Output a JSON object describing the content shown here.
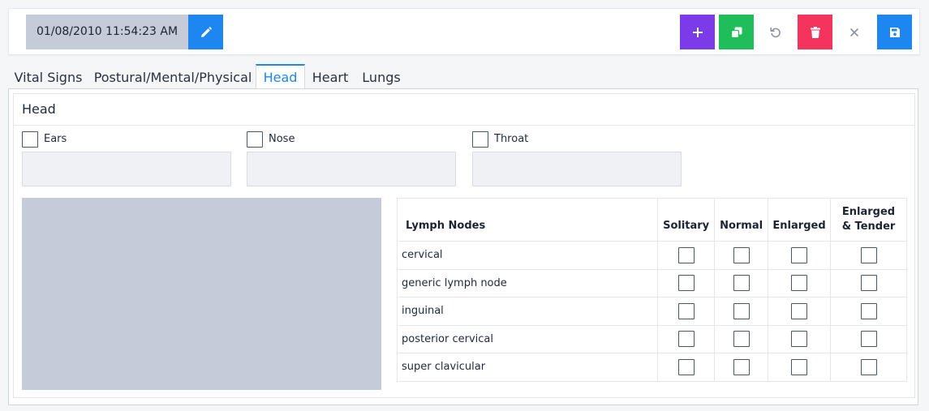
{
  "toolbar": {
    "datetime": "01/08/2010 11:54:23 AM",
    "colors": {
      "add": "#7b3be8",
      "copy": "#1fbe5b",
      "delete": "#f5345e",
      "primary": "#1e86f0"
    },
    "icons": [
      "pencil-icon",
      "plus-icon",
      "copy-icon",
      "undo-icon",
      "trash-icon",
      "close-icon",
      "save-icon"
    ]
  },
  "tabs": [
    {
      "label": "Vital Signs"
    },
    {
      "label": "Postural/Mental/Physical"
    },
    {
      "label": "Head",
      "active": true
    },
    {
      "label": "Heart"
    },
    {
      "label": "Lungs"
    }
  ],
  "panel": {
    "title": "Head",
    "fields": [
      {
        "label": "Ears",
        "checked": false,
        "value": ""
      },
      {
        "label": "Nose",
        "checked": false,
        "value": ""
      },
      {
        "label": "Throat",
        "checked": false,
        "value": ""
      }
    ]
  },
  "lymph_table": {
    "headers": [
      "Lymph Nodes",
      "Solitary",
      "Normal",
      "Enlarged",
      "Enlarged & Tender"
    ],
    "rows": [
      {
        "name": "cervical",
        "checks": [
          false,
          false,
          false,
          false
        ]
      },
      {
        "name": "generic lymph node",
        "checks": [
          false,
          false,
          false,
          false
        ]
      },
      {
        "name": "inguinal",
        "checks": [
          false,
          false,
          false,
          false
        ]
      },
      {
        "name": "posterior cervical",
        "checks": [
          false,
          false,
          false,
          false
        ]
      },
      {
        "name": "super clavicular",
        "checks": [
          false,
          false,
          false,
          false
        ]
      }
    ]
  }
}
